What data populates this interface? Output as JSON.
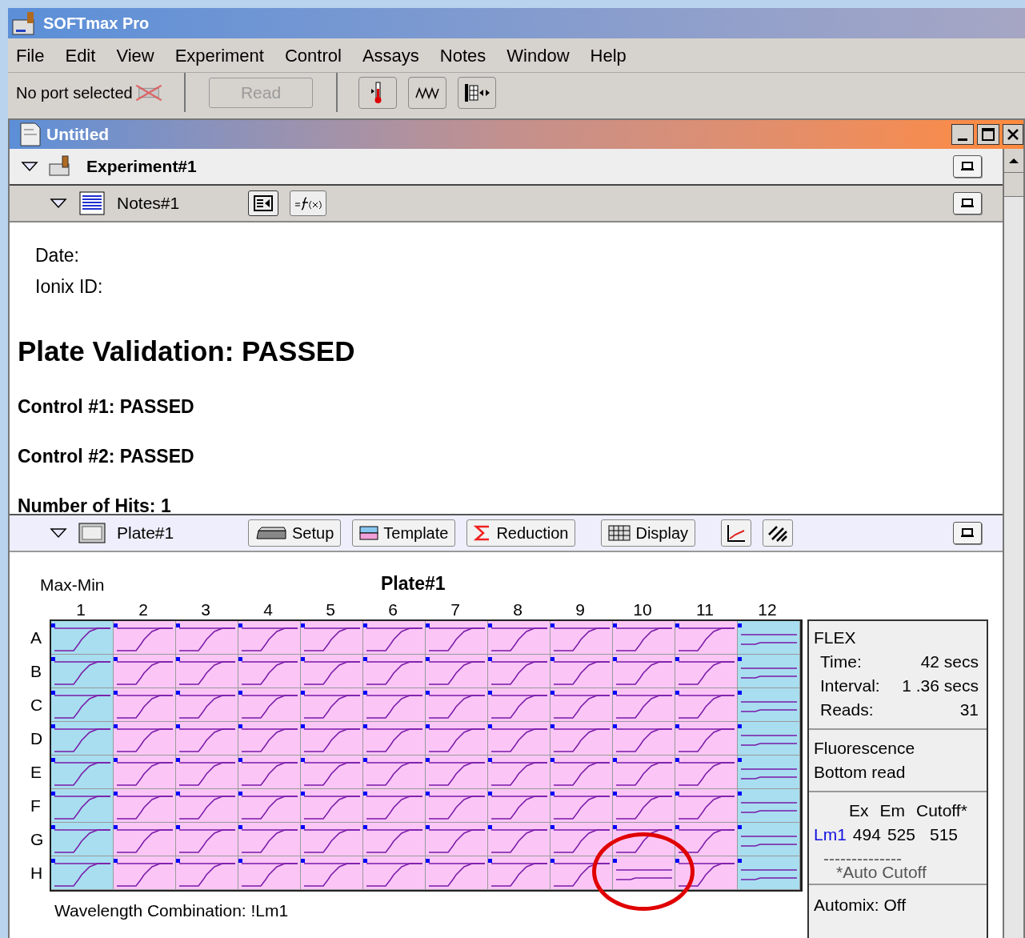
{
  "app": {
    "title": "SOFTmax Pro"
  },
  "menu": [
    "File",
    "Edit",
    "View",
    "Experiment",
    "Control",
    "Assays",
    "Notes",
    "Window",
    "Help"
  ],
  "toolbar": {
    "port_status": "No port selected",
    "read_button": {
      "label": "Read",
      "disabled": true
    }
  },
  "document": {
    "title": "Untitled",
    "experiment": {
      "label": "Experiment#1",
      "expanded": true
    },
    "notes": {
      "label": "Notes#1",
      "expanded": true,
      "lines": [
        {
          "kind": "plain",
          "text": "Date:"
        },
        {
          "kind": "plain",
          "text": "Ionix ID:"
        },
        {
          "kind": "heading",
          "text": "Plate Validation: PASSED"
        },
        {
          "kind": "bold",
          "text": "Control #1: PASSED"
        },
        {
          "kind": "bold",
          "text": "Control #2: PASSED"
        },
        {
          "kind": "bold",
          "text": "Number of Hits: 1"
        }
      ]
    },
    "plate": {
      "label": "Plate#1",
      "expanded": true,
      "buttons": [
        "Setup",
        "Template",
        "Reduction",
        "Display"
      ],
      "display_mode": "Max-Min",
      "title": "Plate#1",
      "columns": [
        {
          "label": "1",
          "color": "#a8def0"
        },
        {
          "label": "2",
          "color": "#fbc6f6"
        },
        {
          "label": "3",
          "color": "#fbc6f6"
        },
        {
          "label": "4",
          "color": "#fbc6f6"
        },
        {
          "label": "5",
          "color": "#fbc6f6"
        },
        {
          "label": "6",
          "color": "#fbc6f6"
        },
        {
          "label": "7",
          "color": "#fbc6f6"
        },
        {
          "label": "8",
          "color": "#fbc6f6"
        },
        {
          "label": "9",
          "color": "#fbc6f6"
        },
        {
          "label": "10",
          "color": "#fbc6f6"
        },
        {
          "label": "11",
          "color": "#fbc6f6"
        },
        {
          "label": "12",
          "color": "#a8def0"
        }
      ],
      "rows": [
        {
          "label": "A",
          "wells": [
            {
              "kind": "rise"
            },
            {
              "kind": "rise"
            },
            {
              "kind": "rise"
            },
            {
              "kind": "rise"
            },
            {
              "kind": "rise"
            },
            {
              "kind": "rise"
            },
            {
              "kind": "rise"
            },
            {
              "kind": "rise"
            },
            {
              "kind": "rise"
            },
            {
              "kind": "rise"
            },
            {
              "kind": "rise"
            },
            {
              "kind": "flat"
            }
          ]
        },
        {
          "label": "B",
          "wells": [
            {
              "kind": "rise"
            },
            {
              "kind": "rise"
            },
            {
              "kind": "rise"
            },
            {
              "kind": "rise"
            },
            {
              "kind": "rise"
            },
            {
              "kind": "rise"
            },
            {
              "kind": "rise"
            },
            {
              "kind": "rise"
            },
            {
              "kind": "rise"
            },
            {
              "kind": "rise"
            },
            {
              "kind": "rise"
            },
            {
              "kind": "flat"
            }
          ]
        },
        {
          "label": "C",
          "wells": [
            {
              "kind": "rise"
            },
            {
              "kind": "rise"
            },
            {
              "kind": "rise"
            },
            {
              "kind": "rise"
            },
            {
              "kind": "rise"
            },
            {
              "kind": "rise"
            },
            {
              "kind": "rise"
            },
            {
              "kind": "rise"
            },
            {
              "kind": "rise"
            },
            {
              "kind": "rise"
            },
            {
              "kind": "rise"
            },
            {
              "kind": "flat"
            }
          ]
        },
        {
          "label": "D",
          "wells": [
            {
              "kind": "rise"
            },
            {
              "kind": "rise"
            },
            {
              "kind": "rise"
            },
            {
              "kind": "rise"
            },
            {
              "kind": "rise"
            },
            {
              "kind": "rise"
            },
            {
              "kind": "rise"
            },
            {
              "kind": "rise"
            },
            {
              "kind": "rise"
            },
            {
              "kind": "rise"
            },
            {
              "kind": "rise"
            },
            {
              "kind": "flat"
            }
          ]
        },
        {
          "label": "E",
          "wells": [
            {
              "kind": "rise"
            },
            {
              "kind": "rise"
            },
            {
              "kind": "rise"
            },
            {
              "kind": "rise"
            },
            {
              "kind": "rise"
            },
            {
              "kind": "rise"
            },
            {
              "kind": "rise"
            },
            {
              "kind": "rise"
            },
            {
              "kind": "rise"
            },
            {
              "kind": "rise"
            },
            {
              "kind": "rise"
            },
            {
              "kind": "flat"
            }
          ]
        },
        {
          "label": "F",
          "wells": [
            {
              "kind": "rise"
            },
            {
              "kind": "rise"
            },
            {
              "kind": "rise"
            },
            {
              "kind": "rise"
            },
            {
              "kind": "rise"
            },
            {
              "kind": "rise"
            },
            {
              "kind": "rise"
            },
            {
              "kind": "rise"
            },
            {
              "kind": "rise"
            },
            {
              "kind": "rise"
            },
            {
              "kind": "rise"
            },
            {
              "kind": "flat"
            }
          ]
        },
        {
          "label": "G",
          "wells": [
            {
              "kind": "rise"
            },
            {
              "kind": "rise"
            },
            {
              "kind": "rise"
            },
            {
              "kind": "rise"
            },
            {
              "kind": "rise"
            },
            {
              "kind": "rise"
            },
            {
              "kind": "rise"
            },
            {
              "kind": "rise"
            },
            {
              "kind": "rise"
            },
            {
              "kind": "rise"
            },
            {
              "kind": "rise"
            },
            {
              "kind": "flat"
            }
          ]
        },
        {
          "label": "H",
          "wells": [
            {
              "kind": "rise"
            },
            {
              "kind": "rise"
            },
            {
              "kind": "rise"
            },
            {
              "kind": "rise"
            },
            {
              "kind": "rise"
            },
            {
              "kind": "rise"
            },
            {
              "kind": "rise"
            },
            {
              "kind": "rise"
            },
            {
              "kind": "rise"
            },
            {
              "kind": "flat",
              "circled": true
            },
            {
              "kind": "rise"
            },
            {
              "kind": "flat"
            }
          ]
        }
      ],
      "footer": "Wavelength Combination: !Lm1",
      "settings": {
        "mode": "FLEX",
        "params": [
          {
            "label": "Time:",
            "value": "42 secs"
          },
          {
            "label": "Interval:",
            "value": "1 .36 secs"
          },
          {
            "label": "Reads:",
            "value": "31"
          }
        ],
        "read_type": [
          "Fluorescence",
          "Bottom read"
        ],
        "wavelength_headers": [
          "Ex",
          "Em",
          "Cutoff*"
        ],
        "wavelength_rows": [
          {
            "name": "Lm1",
            "ex": "494",
            "em": "525",
            "cutoff": "515"
          }
        ],
        "divider": "--------------",
        "note": "*Auto Cutoff",
        "automix": "Automix: Off"
      }
    }
  }
}
